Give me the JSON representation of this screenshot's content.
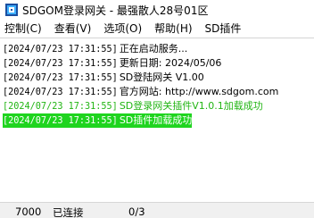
{
  "window": {
    "title": "SDGOM登录网关 - 最强散人28号01区"
  },
  "menu": {
    "items": [
      "控制(C)",
      "查看(V)",
      "选项(O)",
      "帮助(H)",
      "SD插件"
    ]
  },
  "log": {
    "lines": [
      {
        "ts": "[2024/07/23 17:31:55]",
        "msg": "正在启动服务...",
        "style": "normal"
      },
      {
        "ts": "[2024/07/23 17:31:55]",
        "msg": "更新日期: 2024/05/06",
        "style": "normal"
      },
      {
        "ts": "[2024/07/23 17:31:55]",
        "msg": "SD登陆网关 V1.00",
        "style": "normal"
      },
      {
        "ts": "[2024/07/23 17:31:55]",
        "msg": "官方网站: http://www.sdgom.com",
        "style": "normal"
      },
      {
        "ts": "[2024/07/23 17:31:55]",
        "msg": "SD登录网关插件V1.0.1加载成功",
        "style": "green"
      },
      {
        "ts": "[2024/07/23 17:31:55]",
        "msg": "SD插件加载成功",
        "style": "selected"
      }
    ]
  },
  "status": {
    "port": "7000",
    "connection": "已连接",
    "count": "0/3"
  },
  "colors": {
    "success_text": "#22b514",
    "highlight": "#1fd41f"
  }
}
